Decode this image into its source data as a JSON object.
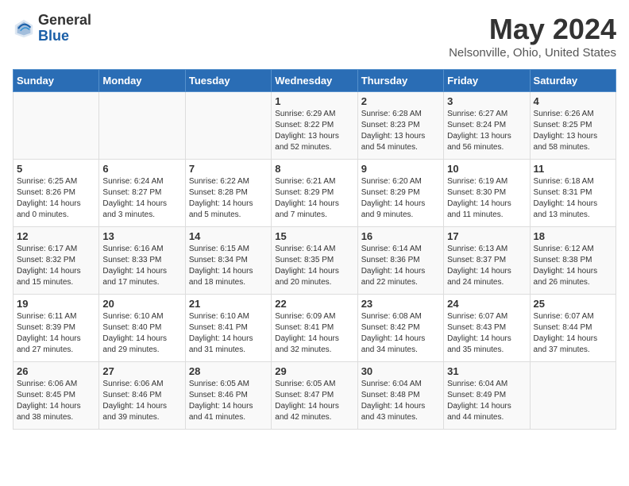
{
  "header": {
    "logo_general": "General",
    "logo_blue": "Blue",
    "month": "May 2024",
    "location": "Nelsonville, Ohio, United States"
  },
  "weekdays": [
    "Sunday",
    "Monday",
    "Tuesday",
    "Wednesday",
    "Thursday",
    "Friday",
    "Saturday"
  ],
  "weeks": [
    [
      {
        "day": "",
        "sunrise": "",
        "sunset": "",
        "daylight": ""
      },
      {
        "day": "",
        "sunrise": "",
        "sunset": "",
        "daylight": ""
      },
      {
        "day": "",
        "sunrise": "",
        "sunset": "",
        "daylight": ""
      },
      {
        "day": "1",
        "sunrise": "Sunrise: 6:29 AM",
        "sunset": "Sunset: 8:22 PM",
        "daylight": "Daylight: 13 hours and 52 minutes."
      },
      {
        "day": "2",
        "sunrise": "Sunrise: 6:28 AM",
        "sunset": "Sunset: 8:23 PM",
        "daylight": "Daylight: 13 hours and 54 minutes."
      },
      {
        "day": "3",
        "sunrise": "Sunrise: 6:27 AM",
        "sunset": "Sunset: 8:24 PM",
        "daylight": "Daylight: 13 hours and 56 minutes."
      },
      {
        "day": "4",
        "sunrise": "Sunrise: 6:26 AM",
        "sunset": "Sunset: 8:25 PM",
        "daylight": "Daylight: 13 hours and 58 minutes."
      }
    ],
    [
      {
        "day": "5",
        "sunrise": "Sunrise: 6:25 AM",
        "sunset": "Sunset: 8:26 PM",
        "daylight": "Daylight: 14 hours and 0 minutes."
      },
      {
        "day": "6",
        "sunrise": "Sunrise: 6:24 AM",
        "sunset": "Sunset: 8:27 PM",
        "daylight": "Daylight: 14 hours and 3 minutes."
      },
      {
        "day": "7",
        "sunrise": "Sunrise: 6:22 AM",
        "sunset": "Sunset: 8:28 PM",
        "daylight": "Daylight: 14 hours and 5 minutes."
      },
      {
        "day": "8",
        "sunrise": "Sunrise: 6:21 AM",
        "sunset": "Sunset: 8:29 PM",
        "daylight": "Daylight: 14 hours and 7 minutes."
      },
      {
        "day": "9",
        "sunrise": "Sunrise: 6:20 AM",
        "sunset": "Sunset: 8:29 PM",
        "daylight": "Daylight: 14 hours and 9 minutes."
      },
      {
        "day": "10",
        "sunrise": "Sunrise: 6:19 AM",
        "sunset": "Sunset: 8:30 PM",
        "daylight": "Daylight: 14 hours and 11 minutes."
      },
      {
        "day": "11",
        "sunrise": "Sunrise: 6:18 AM",
        "sunset": "Sunset: 8:31 PM",
        "daylight": "Daylight: 14 hours and 13 minutes."
      }
    ],
    [
      {
        "day": "12",
        "sunrise": "Sunrise: 6:17 AM",
        "sunset": "Sunset: 8:32 PM",
        "daylight": "Daylight: 14 hours and 15 minutes."
      },
      {
        "day": "13",
        "sunrise": "Sunrise: 6:16 AM",
        "sunset": "Sunset: 8:33 PM",
        "daylight": "Daylight: 14 hours and 17 minutes."
      },
      {
        "day": "14",
        "sunrise": "Sunrise: 6:15 AM",
        "sunset": "Sunset: 8:34 PM",
        "daylight": "Daylight: 14 hours and 18 minutes."
      },
      {
        "day": "15",
        "sunrise": "Sunrise: 6:14 AM",
        "sunset": "Sunset: 8:35 PM",
        "daylight": "Daylight: 14 hours and 20 minutes."
      },
      {
        "day": "16",
        "sunrise": "Sunrise: 6:14 AM",
        "sunset": "Sunset: 8:36 PM",
        "daylight": "Daylight: 14 hours and 22 minutes."
      },
      {
        "day": "17",
        "sunrise": "Sunrise: 6:13 AM",
        "sunset": "Sunset: 8:37 PM",
        "daylight": "Daylight: 14 hours and 24 minutes."
      },
      {
        "day": "18",
        "sunrise": "Sunrise: 6:12 AM",
        "sunset": "Sunset: 8:38 PM",
        "daylight": "Daylight: 14 hours and 26 minutes."
      }
    ],
    [
      {
        "day": "19",
        "sunrise": "Sunrise: 6:11 AM",
        "sunset": "Sunset: 8:39 PM",
        "daylight": "Daylight: 14 hours and 27 minutes."
      },
      {
        "day": "20",
        "sunrise": "Sunrise: 6:10 AM",
        "sunset": "Sunset: 8:40 PM",
        "daylight": "Daylight: 14 hours and 29 minutes."
      },
      {
        "day": "21",
        "sunrise": "Sunrise: 6:10 AM",
        "sunset": "Sunset: 8:41 PM",
        "daylight": "Daylight: 14 hours and 31 minutes."
      },
      {
        "day": "22",
        "sunrise": "Sunrise: 6:09 AM",
        "sunset": "Sunset: 8:41 PM",
        "daylight": "Daylight: 14 hours and 32 minutes."
      },
      {
        "day": "23",
        "sunrise": "Sunrise: 6:08 AM",
        "sunset": "Sunset: 8:42 PM",
        "daylight": "Daylight: 14 hours and 34 minutes."
      },
      {
        "day": "24",
        "sunrise": "Sunrise: 6:07 AM",
        "sunset": "Sunset: 8:43 PM",
        "daylight": "Daylight: 14 hours and 35 minutes."
      },
      {
        "day": "25",
        "sunrise": "Sunrise: 6:07 AM",
        "sunset": "Sunset: 8:44 PM",
        "daylight": "Daylight: 14 hours and 37 minutes."
      }
    ],
    [
      {
        "day": "26",
        "sunrise": "Sunrise: 6:06 AM",
        "sunset": "Sunset: 8:45 PM",
        "daylight": "Daylight: 14 hours and 38 minutes."
      },
      {
        "day": "27",
        "sunrise": "Sunrise: 6:06 AM",
        "sunset": "Sunset: 8:46 PM",
        "daylight": "Daylight: 14 hours and 39 minutes."
      },
      {
        "day": "28",
        "sunrise": "Sunrise: 6:05 AM",
        "sunset": "Sunset: 8:46 PM",
        "daylight": "Daylight: 14 hours and 41 minutes."
      },
      {
        "day": "29",
        "sunrise": "Sunrise: 6:05 AM",
        "sunset": "Sunset: 8:47 PM",
        "daylight": "Daylight: 14 hours and 42 minutes."
      },
      {
        "day": "30",
        "sunrise": "Sunrise: 6:04 AM",
        "sunset": "Sunset: 8:48 PM",
        "daylight": "Daylight: 14 hours and 43 minutes."
      },
      {
        "day": "31",
        "sunrise": "Sunrise: 6:04 AM",
        "sunset": "Sunset: 8:49 PM",
        "daylight": "Daylight: 14 hours and 44 minutes."
      },
      {
        "day": "",
        "sunrise": "",
        "sunset": "",
        "daylight": ""
      }
    ]
  ]
}
